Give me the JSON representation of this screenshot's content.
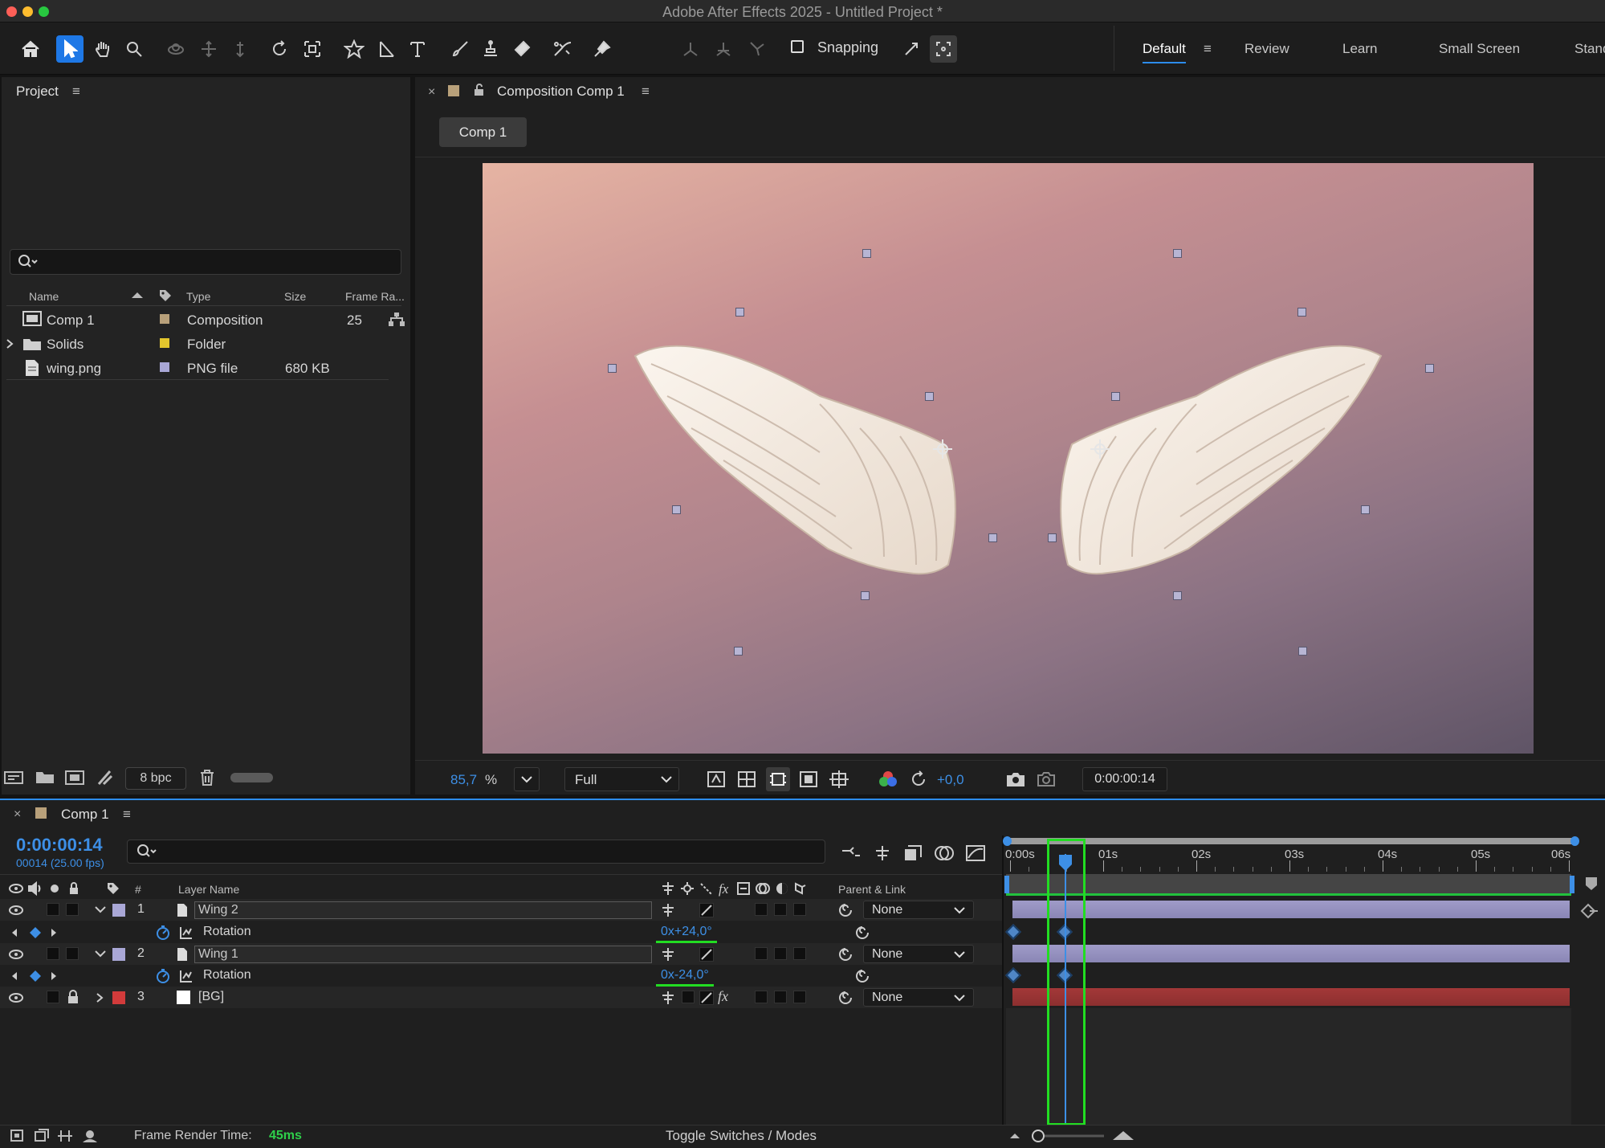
{
  "window": {
    "title": "Adobe After Effects 2025 - Untitled Project *"
  },
  "toolbar": {
    "snapping_label": "Snapping",
    "tools": [
      "home-icon",
      "selection-tool-icon",
      "hand-tool-icon",
      "zoom-tool-icon",
      "orbit-camera-icon",
      "pan-camera-icon",
      "dolly-camera-icon",
      "rotate-tool-icon",
      "pan-behind-icon",
      "shape-star-icon",
      "pen-tool-icon",
      "type-tool-icon",
      "brush-tool-icon",
      "clone-stamp-icon",
      "eraser-tool-icon",
      "roto-brush-icon",
      "puppet-pin-icon"
    ]
  },
  "workspaces": {
    "items": [
      "Default",
      "Review",
      "Learn",
      "Small Screen",
      "Stand"
    ],
    "active": "Default"
  },
  "project": {
    "title": "Project",
    "columns": {
      "name": "Name",
      "type": "Type",
      "size": "Size",
      "frame_rate": "Frame Ra..."
    },
    "items": [
      {
        "name": "Comp 1",
        "type": "Composition",
        "size": "",
        "frame_rate": "25",
        "color": "#b8a07a",
        "icon": "composition-icon"
      },
      {
        "name": "Solids",
        "type": "Folder",
        "size": "",
        "frame_rate": "",
        "color": "#e3c62d",
        "icon": "folder-icon"
      },
      {
        "name": "wing.png",
        "type": "PNG file",
        "size": "680 KB",
        "frame_rate": "",
        "color": "#a9a7d6",
        "icon": "file-icon"
      }
    ],
    "bpc": "8 bpc"
  },
  "composition": {
    "tab_title": "Composition Comp 1",
    "sub_tab": "Comp 1",
    "zoom": "85,7",
    "zoom_unit": "%",
    "resolution": "Full",
    "exposure": "+0,0",
    "timecode": "0:00:00:14"
  },
  "timeline": {
    "tab": "Comp 1",
    "timecode": "0:00:00:14",
    "frame_info": "00014 (25.00 fps)",
    "headers": {
      "number": "#",
      "layer_name": "Layer Name",
      "parent": "Parent & Link"
    },
    "ruler": [
      "0:00s",
      "01s",
      "02s",
      "03s",
      "04s",
      "05s",
      "06s"
    ],
    "layers": [
      {
        "num": "1",
        "name": "Wing 2",
        "parent": "None",
        "label_color": "#a9a7d6"
      },
      {
        "prop": "Rotation",
        "value": "0x+24,0°"
      },
      {
        "num": "2",
        "name": "Wing 1",
        "parent": "None",
        "label_color": "#a9a7d6"
      },
      {
        "prop": "Rotation",
        "value": "0x-24,0°"
      },
      {
        "num": "3",
        "name": "[BG]",
        "parent": "None",
        "label_color": "#d23b3b"
      }
    ],
    "render_label": "Frame Render Time:",
    "render_value": "45ms",
    "toggle_label": "Toggle Switches / Modes",
    "highlight_color": "#22dd22"
  }
}
